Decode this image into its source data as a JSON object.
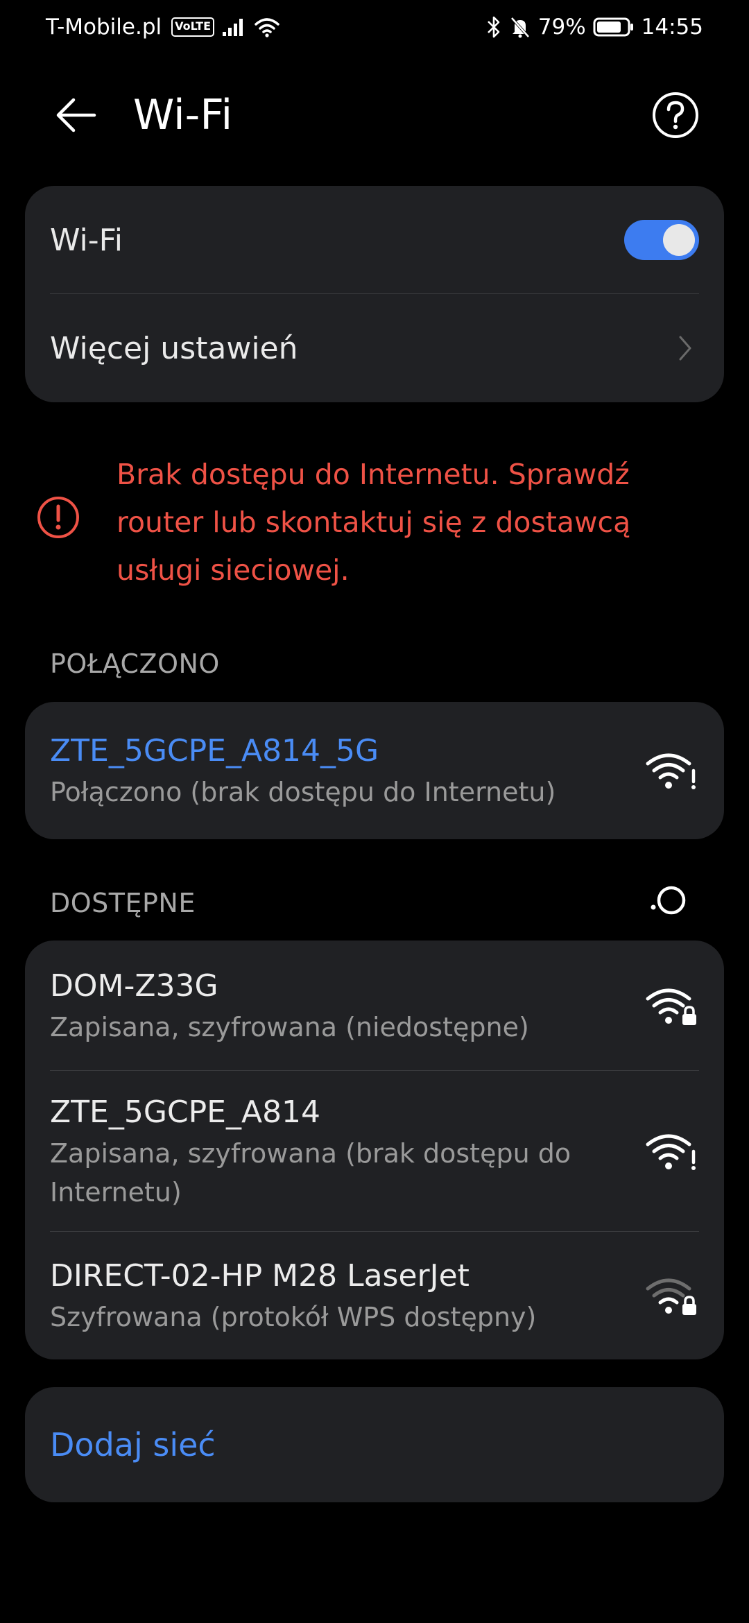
{
  "status_bar": {
    "carrier": "T-Mobile.pl",
    "volte": "VoLTE",
    "battery": "79%",
    "time": "14:55"
  },
  "header": {
    "title": "Wi-Fi"
  },
  "settings": {
    "wifi_label": "Wi-Fi",
    "wifi_enabled": true,
    "more_settings_label": "Więcej ustawień"
  },
  "warning": {
    "text": "Brak dostępu do Internetu. Sprawdź router lub skontaktuj się z dostawcą usługi sieciowej."
  },
  "connected": {
    "section_label": "POŁĄCZONO",
    "network": {
      "name": "ZTE_5GCPE_A814_5G",
      "status": "Połączono (brak dostępu do Internetu)",
      "icon": "wifi-no-internet-icon"
    }
  },
  "available": {
    "section_label": "DOSTĘPNE",
    "networks": [
      {
        "name": "DOM-Z33G",
        "status": "Zapisana, szyfrowana (niedostępne)",
        "icon": "wifi-locked-icon"
      },
      {
        "name": "ZTE_5GCPE_A814",
        "status": "Zapisana, szyfrowana (brak dostępu do Internetu)",
        "icon": "wifi-no-internet-icon"
      },
      {
        "name": "DIRECT-02-HP M28 LaserJet",
        "status": "Szyfrowana (protokół WPS dostępny)",
        "icon": "wifi-locked-weak-icon"
      }
    ]
  },
  "add_network": {
    "label": "Dodaj sieć"
  },
  "colors": {
    "background": "#000000",
    "card": "#202124",
    "accent": "#3d7cf0",
    "link": "#4a8cf5",
    "error": "#ef5246"
  }
}
